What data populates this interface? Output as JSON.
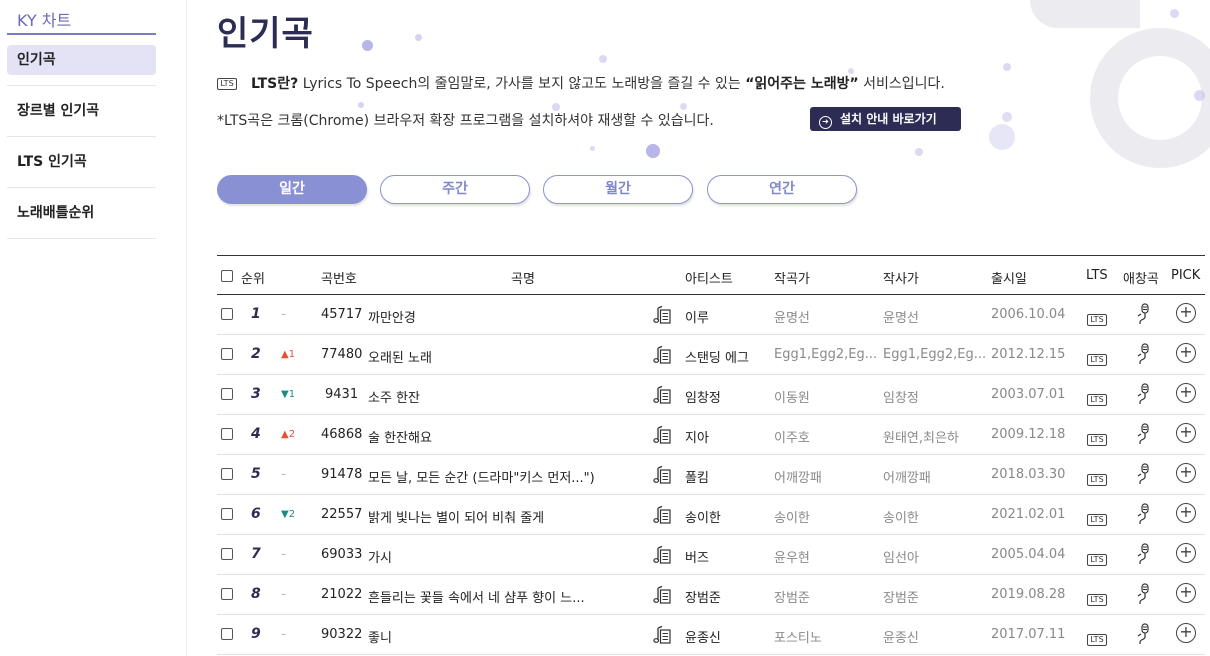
{
  "sidebar": {
    "brand": "KY 차트",
    "items": [
      {
        "label": "인기곡",
        "active": true
      },
      {
        "label": "장르별 인기곡",
        "active": false
      },
      {
        "label": "LTS 인기곡",
        "active": false
      },
      {
        "label": "노래배틀순위",
        "active": false
      }
    ]
  },
  "header": {
    "title": "인기곡",
    "lts_badge": "LTS",
    "intro_lead": "LTS란?",
    "intro_mid": " Lyrics To Speech의 줄임말로, 가사를 보지 않고도 노래방을 즐길 수 있는 ",
    "intro_em": "“읽어주는 노래방”",
    "intro_tail": " 서비스입니다.",
    "note": "*LTS곡은 크롬(Chrome) 브라우저 확장 프로그램을 설치하셔야 재생할 수 있습니다.",
    "guide_button": "설치 안내 바로가기"
  },
  "tabs": [
    {
      "label": "일간",
      "active": true
    },
    {
      "label": "주간",
      "active": false
    },
    {
      "label": "월간",
      "active": false
    },
    {
      "label": "연간",
      "active": false
    }
  ],
  "table": {
    "headers": {
      "rank": "순위",
      "number": "곡번호",
      "title": "곡명",
      "artist": "아티스트",
      "composer": "작곡가",
      "lyricist": "작사가",
      "release": "출시일",
      "lts": "LTS",
      "favorite": "애창곡",
      "pick": "PICK"
    },
    "rows": [
      {
        "rank": "1",
        "change": "–",
        "dir": "same",
        "number": "45717",
        "title": "까만안경",
        "artist": "이루",
        "composer": "윤명선",
        "lyricist": "윤명선",
        "release": "2006.10.04"
      },
      {
        "rank": "2",
        "change": "▲1",
        "dir": "up",
        "number": "77480",
        "title": "오래된 노래",
        "artist": "스탠딩 에그",
        "composer": "Egg1,Egg2,Eg...",
        "lyricist": "Egg1,Egg2,Eg...",
        "release": "2012.12.15"
      },
      {
        "rank": "3",
        "change": "▼1",
        "dir": "down",
        "number": "9431",
        "title": "소주 한잔",
        "artist": "임창정",
        "composer": "이동원",
        "lyricist": "임창정",
        "release": "2003.07.01"
      },
      {
        "rank": "4",
        "change": "▲2",
        "dir": "up",
        "number": "46868",
        "title": "술 한잔해요",
        "artist": "지아",
        "composer": "이주호",
        "lyricist": "원태연,최은하",
        "release": "2009.12.18"
      },
      {
        "rank": "5",
        "change": "–",
        "dir": "same",
        "number": "91478",
        "title": "모든 날, 모든 순간 (드라마\"키스 먼저...\")",
        "artist": "폴킴",
        "composer": "어깨깡패",
        "lyricist": "어깨깡패",
        "release": "2018.03.30"
      },
      {
        "rank": "6",
        "change": "▼2",
        "dir": "down",
        "number": "22557",
        "title": "밝게 빛나는 별이 되어 비춰 줄게",
        "artist": "송이한",
        "composer": "송이한",
        "lyricist": "송이한",
        "release": "2021.02.01"
      },
      {
        "rank": "7",
        "change": "–",
        "dir": "same",
        "number": "69033",
        "title": "가시",
        "artist": "버즈",
        "composer": "윤우현",
        "lyricist": "임선아",
        "release": "2005.04.04"
      },
      {
        "rank": "8",
        "change": "–",
        "dir": "same",
        "number": "21022",
        "title": "흔들리는 꽃들 속에서 네 샴푸 향이 느...",
        "artist": "장범준",
        "composer": "장범준",
        "lyricist": "장범준",
        "release": "2019.08.28"
      },
      {
        "rank": "9",
        "change": "–",
        "dir": "same",
        "number": "90322",
        "title": "좋니",
        "artist": "윤종신",
        "composer": "포스티노",
        "lyricist": "윤종신",
        "release": "2017.07.11"
      }
    ],
    "lts_label": "LTS",
    "pick_symbol": "+"
  }
}
